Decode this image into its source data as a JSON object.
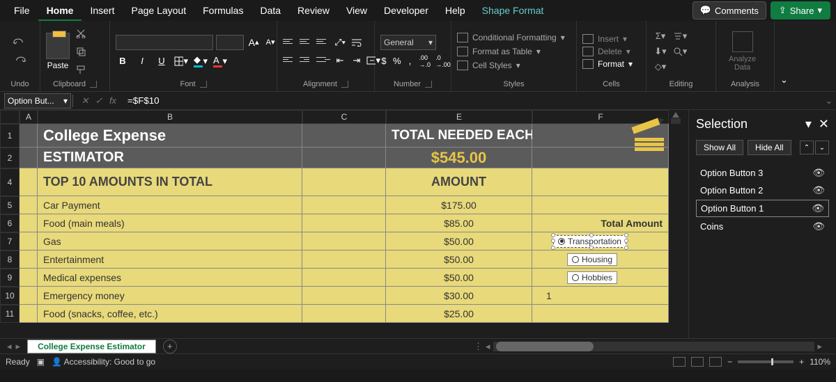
{
  "menu": {
    "items": [
      "File",
      "Home",
      "Insert",
      "Page Layout",
      "Formulas",
      "Data",
      "Review",
      "View",
      "Developer",
      "Help",
      "Shape Format"
    ],
    "active": "Home",
    "comments": "Comments",
    "share": "Share"
  },
  "ribbon": {
    "undo": "Undo",
    "clipboard": {
      "label": "Clipboard",
      "paste": "Paste"
    },
    "font": {
      "label": "Font",
      "bold": "B",
      "italic": "I",
      "underline": "U",
      "increase": "A",
      "decrease": "A"
    },
    "alignment": {
      "label": "Alignment"
    },
    "number": {
      "label": "Number",
      "format": "General",
      "currency": "$",
      "percent": "%",
      "comma": ","
    },
    "styles": {
      "label": "Styles",
      "cond": "Conditional Formatting",
      "table": "Format as Table",
      "cell": "Cell Styles"
    },
    "cells": {
      "label": "Cells",
      "insert": "Insert",
      "delete": "Delete",
      "format": "Format"
    },
    "editing": {
      "label": "Editing"
    },
    "analysis": {
      "label": "Analysis",
      "analyze": "Analyze",
      "data": "Data"
    }
  },
  "formula_bar": {
    "name_box": "Option But...",
    "formula": "=$F$10"
  },
  "columns": [
    "A",
    "B",
    "C",
    "E",
    "F"
  ],
  "rows": {
    "title1": {
      "num": "1",
      "b": "College Expense",
      "e": "TOTAL NEEDED EACH MONTH:"
    },
    "title2": {
      "num": "2",
      "b": "ESTIMATOR",
      "e": "$545.00"
    },
    "section": {
      "num": "4",
      "b": "TOP 10 AMOUNTS IN TOTAL",
      "e": "AMOUNT"
    },
    "data": [
      {
        "num": "5",
        "b": "Car Payment",
        "e": "$175.00",
        "f": ""
      },
      {
        "num": "6",
        "b": "Food (main meals)",
        "e": "$85.00",
        "f": "Total Amount"
      },
      {
        "num": "7",
        "b": "Gas",
        "e": "$50.00",
        "f": ""
      },
      {
        "num": "8",
        "b": "Entertainment",
        "e": "$50.00",
        "f": ""
      },
      {
        "num": "9",
        "b": "Medical expenses",
        "e": "$50.00",
        "f": ""
      },
      {
        "num": "10",
        "b": "Emergency money",
        "e": "$30.00",
        "f": "1"
      },
      {
        "num": "11",
        "b": "Food (snacks, coffee, etc.)",
        "e": "$25.00",
        "f": ""
      }
    ]
  },
  "option_buttons": {
    "opt1": "Transportation",
    "opt2": "Housing",
    "opt3": "Hobbies"
  },
  "selection_pane": {
    "title": "Selection",
    "show_all": "Show All",
    "hide_all": "Hide All",
    "items": [
      "Option Button 3",
      "Option Button 2",
      "Option Button 1",
      "Coins"
    ],
    "selected": "Option Button 1"
  },
  "sheet_tab": "College Expense Estimator",
  "status": {
    "ready": "Ready",
    "accessibility": "Accessibility: Good to go",
    "zoom": "110%"
  }
}
